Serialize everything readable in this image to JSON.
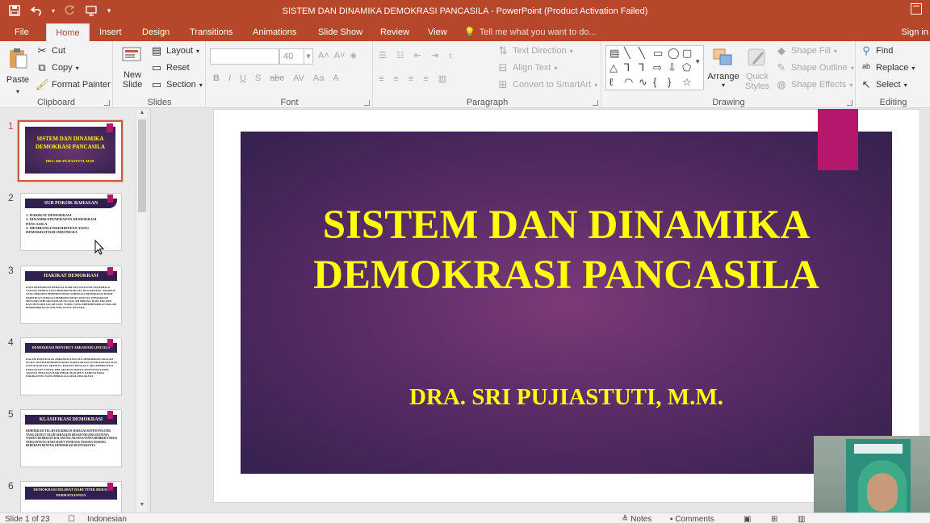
{
  "window": {
    "title": "SISTEM DAN DINAMIKA DEMOKRASI PANCASILA - PowerPoint (Product Activation Failed)"
  },
  "quick_access": [
    "save-icon",
    "undo-icon",
    "redo-icon",
    "present-icon"
  ],
  "tabs": [
    "File",
    "Home",
    "Insert",
    "Design",
    "Transitions",
    "Animations",
    "Slide Show",
    "Review",
    "View"
  ],
  "active_tab": "Home",
  "tell_me": "Tell me what you want to do...",
  "sign_in": "Sign in",
  "ribbon": {
    "clipboard": {
      "label": "Clipboard",
      "paste": "Paste",
      "cut": "Cut",
      "copy": "Copy",
      "format_painter": "Format Painter"
    },
    "slides": {
      "label": "Slides",
      "new_slide_line1": "New",
      "new_slide_line2": "Slide",
      "layout": "Layout",
      "reset": "Reset",
      "section": "Section"
    },
    "font": {
      "label": "Font",
      "font_name": "",
      "font_size": "40"
    },
    "paragraph": {
      "label": "Paragraph",
      "text_direction": "Text Direction",
      "align_text": "Align Text",
      "convert_smartart": "Convert to SmartArt"
    },
    "drawing": {
      "label": "Drawing",
      "arrange": "Arrange",
      "quick_styles_line1": "Quick",
      "quick_styles_line2": "Styles",
      "shape_fill": "Shape Fill",
      "shape_outline": "Shape Outline",
      "shape_effects": "Shape Effects"
    },
    "editing": {
      "label": "Editing",
      "find": "Find",
      "replace": "Replace",
      "select": "Select"
    }
  },
  "thumbnails": [
    {
      "num": "1",
      "title": "SISTEM DAN DINAMIKA DEMOKRASI PANCASILA",
      "subtitle": "DRA. SRI PUJIASTUTI, M.M."
    },
    {
      "num": "2",
      "title": "SUB POKOK BAHASAN",
      "lines": [
        "1. HAKIKAT DEMOKRASI",
        "2. DINAMIKAPENERAPAN DEMOKRASI PANCASILA",
        "3. MEMBANGUNKEHIDUPAN YANG DEMOKRATISDI INDONESIA"
      ]
    },
    {
      "num": "3",
      "title": "HAKIKAT DEMOKRASI",
      "text": "KATA DEMOKRASI BERASAL DARI DUA KATA DALAM BAHASA YUNANI, DEMOS YANG BERARTI RAKYAT, DAN KRATOS / KRATEIN YANG BERARTI PEMERINTAHAN SEHINGGA DEMOKRASI DAPAT DIARTIKAN SEBAGAI PEMERINTAHAN RAKYAT. DEMOKRASI MENJADI SEBUAH KATA KUNCI DALAM BIDANG ILMU POLITIK DAN MENJADI SALAH SATU TOPIK YANG DIPERDEBATKAN DALAM PERKEMBANGAN POLITIK SUATU NEGARA."
    },
    {
      "num": "4",
      "title": "DEMOKRASI MENURUT ABRAHAM LINCOLN",
      "text": "DALAM PANDANGAN ABRAHAM LINCOLN DEMOKRASI ADALAH SUATU SISTEM PEMERINTAHAN DARI RAKYAT, OLEH RAKYAT, DAN UNTUK RAKYAT. ARTINYA, RAKYAT DENGAN CARA MEMPUNYAI KEKUASAAN UNTUK MELAKUKAN SEMUA AKTIVITAS TANPA ADANYA TEKANAN DARI PIHAK MANAPUN KARENA PADA HAKIKATNYA YANG BERKUASA ADALAH RAKYAT."
    },
    {
      "num": "5",
      "title": "KLASIFIKASI DEMOKRASI",
      "text": "DEMOKRASI TELAH DIJADIKAN SEBAGAI SISTEM POLITIK YANG DIANUT OLEH SEBAGIAN BESAR NEGARA DI DUNIA NAMUN DEMIKIAN DALAM PELAKSANAANNYA BERBEDA-BEDA TERGANTUNG DARI SUDUT PANDANG MASING-MASING. BEBERAPA BENTUK DEMOKRASI DIANTARANYA"
    },
    {
      "num": "6",
      "title": "DEMOKRASI DILIHAT DARI TITIK BERAT PERHATIANNYA"
    }
  ],
  "slide": {
    "title_line1": "SISTEM DAN DINAMIKA",
    "title_line2": "DEMOKRASI PANCASILA",
    "subtitle": "DRA. SRI PUJIASTUTI, M.M.",
    "title_color": "#ffff00",
    "accent_color": "#b5176c"
  },
  "status": {
    "slide_of": "Slide 1 of 23",
    "language": "Indonesian",
    "notes": "Notes",
    "comments": "Comments"
  },
  "colors": {
    "brand": "#b7472a",
    "ribbon_bg": "#f3f3f3"
  }
}
